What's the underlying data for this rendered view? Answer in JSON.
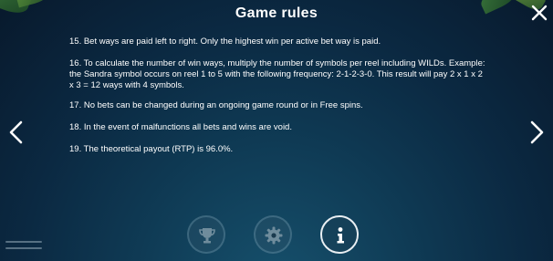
{
  "header": {
    "title": "Game rules",
    "close_icon": "close-icon"
  },
  "navigation": {
    "prev_icon": "chevron-left-icon",
    "next_icon": "chevron-right-icon"
  },
  "rules": [
    {
      "text": "15. Bet ways are paid left to right. Only the highest win per active bet way is paid."
    },
    {
      "text": "16. To calculate the number of win ways, multiply the number of symbols per reel including WILDs. Example: the Sandra symbol occurs on reel 1 to 5 with the following frequency:  2-1-2-3-0. This result will pay 2 x 1 x 2 x 3 = 12 ways with 4 symbols."
    },
    {
      "text": "17. No bets can be changed during an ongoing game round or in Free spins."
    },
    {
      "text": "18. In the event of malfunctions all bets and wins are void."
    },
    {
      "text": "19. The theoretical payout (RTP) is 96.0%."
    }
  ],
  "bottom_bar": {
    "buttons": [
      {
        "icon": "trophy-icon",
        "active": false
      },
      {
        "icon": "gear-icon",
        "active": false
      },
      {
        "icon": "info-icon",
        "active": true
      }
    ]
  },
  "menu": {
    "icon": "menu-icon"
  },
  "colors": {
    "background_top": "#08192c",
    "background_bottom": "#16506c",
    "text": "#ffffff",
    "dim_icon": "#6f8c9c"
  }
}
